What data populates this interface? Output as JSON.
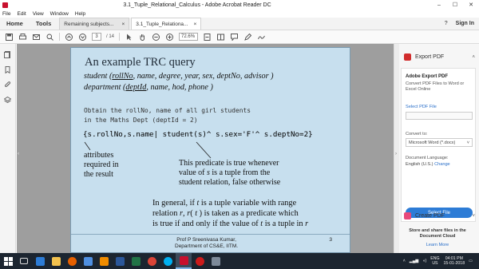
{
  "window": {
    "title": "3.1_Tuple_Relational_Calculus - Adobe Acrobat Reader DC",
    "controls": [
      "–",
      "☐",
      "✕"
    ]
  },
  "menu": [
    "File",
    "Edit",
    "View",
    "Window",
    "Help"
  ],
  "tabs": {
    "home": "Home",
    "tools": "Tools",
    "documents": [
      {
        "label": "Remaining subjects...",
        "close": "×"
      },
      {
        "label": "3.1_Tuple_Relationa...",
        "close": "×"
      }
    ],
    "signin": "Sign In"
  },
  "toolbar": {
    "page_current": "3",
    "page_total": "/ 14",
    "zoom": "72.6%"
  },
  "slide": {
    "heading": "An example TRC query",
    "schema1": {
      "prefix": "student (",
      "key": "rollNo",
      "rest": ", name, degree, year, sex, deptNo, advisor )"
    },
    "schema2": {
      "prefix": "department (",
      "key": "deptId",
      "rest": ", name, hod, phone )"
    },
    "desc1": "Obtain the rollNo, name of all girl students",
    "desc2": "in the Maths Dept (deptId = 2)",
    "query": "{s.rollNo,s.name| student(s)^ s.sex='F'^ s.deptNo=2}",
    "ann_left": [
      "attributes",
      "required in",
      "the result"
    ],
    "ann_right": {
      "line1": "This predicate is true whenever",
      "line2_pre": "value of ",
      "line2_var": "s",
      "line2_post": " is a tuple from the",
      "line3": "student relation, false otherwise"
    },
    "para": {
      "l1_a": "In general, if ",
      "l1_var": "t",
      "l1_b": " is a tuple variable with range",
      "l2_a": "relation ",
      "l2_r": "r",
      "l2_b": ", ",
      "l2_rt": "r",
      "l2_c": "( ",
      "l2_t": "t",
      "l2_d": " ) is taken as a predicate which",
      "l3_a": "is true if and only if the value of ",
      "l3_t": "t",
      "l3_b": " is a tuple in ",
      "l3_r": "r"
    },
    "footer_author1": "Prof P Sreenivasa Kumar,",
    "footer_author2": "Department of CS&E, IITM.",
    "page_number": "3"
  },
  "rightpanel": {
    "export_title": "Export PDF",
    "card_title": "Adobe Export PDF",
    "card_desc": "Convert PDF Files to Word or Excel Online",
    "select_pdf": "Select PDF File",
    "convert_to": "Convert to:",
    "convert_value": "Microsoft Word (*.docx)",
    "doc_lang": "Document Language:",
    "lang_value": "English (U.S.)",
    "lang_change": "Change",
    "select_file_btn": "Select File",
    "create_title": "Create PDF",
    "store_text": "Store and share files in the Document Cloud",
    "learn_more": "Learn More"
  },
  "taskbar": {
    "lang1": "ENG",
    "lang2": "US",
    "time": "04:01 PM",
    "date": "15-01-2018"
  },
  "colors": {
    "slide_bg": "#c7dfee",
    "accent_blue": "#2d7cd6",
    "acrobat_red": "#d12c2c",
    "taskbar": "#1c2530"
  }
}
